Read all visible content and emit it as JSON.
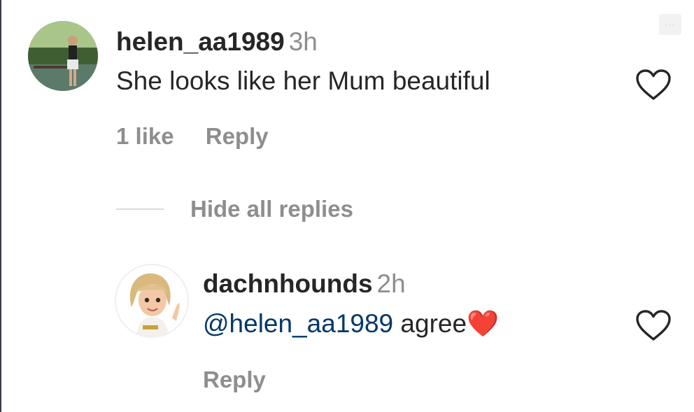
{
  "comment": {
    "username": "helen_aa1989",
    "time": "3h",
    "text": "She looks like her Mum beautiful",
    "likes": "1 like",
    "reply_label": "Reply"
  },
  "thread": {
    "hide_replies_label": "Hide all replies"
  },
  "reply": {
    "username": "dachnhounds",
    "time": "2h",
    "mention": "@helen_aa1989",
    "text": " agree",
    "emoji": "❤️",
    "reply_label": "Reply"
  },
  "more_label": "···",
  "colors": {
    "text": "#262626",
    "secondary": "#8e8e8e",
    "mention": "#00376b",
    "divider": "#dbdbdb"
  }
}
